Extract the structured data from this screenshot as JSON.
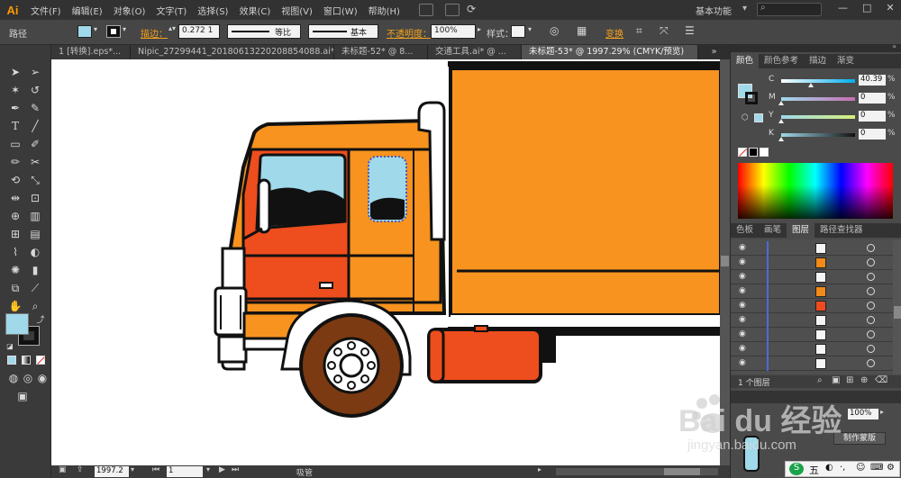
{
  "app": {
    "logo": "Ai",
    "menu": [
      "文件(F)",
      "编辑(E)",
      "对象(O)",
      "文字(T)",
      "选择(S)",
      "效果(C)",
      "视图(V)",
      "窗口(W)",
      "帮助(H)"
    ],
    "workspace": "基本功能",
    "search_placeholder": "",
    "window_buttons": [
      "—",
      "□",
      "✕"
    ]
  },
  "control_bar": {
    "selection_label": "路径",
    "stroke_label": "描边：",
    "stroke_weight": "0.272 1",
    "stroke_profile": "等比",
    "brush": "基本",
    "opacity_label": "不透明度：",
    "opacity_value": "100%",
    "style_label": "样式：",
    "transform_label": "变换",
    "fill_color": "#9fd9ea",
    "stroke_color": "#111111"
  },
  "tabs": [
    {
      "label": "1 [转换].eps*...",
      "active": false
    },
    {
      "label": "Nipic_27299441_20180613220208854088.ai* ...",
      "active": false
    },
    {
      "label": "未标题-52* @ 8...",
      "active": false
    },
    {
      "label": "交通工具.ai* @ ...",
      "active": false
    },
    {
      "label": "未标题-53* @ 1997.29% (CMYK/预览)",
      "active": true
    }
  ],
  "status_bar": {
    "zoom": "1997.2",
    "page": "1",
    "tool_name": "吸管"
  },
  "color_panel": {
    "tabs": [
      {
        "label": "颜色",
        "active": true
      },
      {
        "label": "颜色参考",
        "active": false
      },
      {
        "label": "描边",
        "active": false
      },
      {
        "label": "渐变",
        "active": false
      }
    ],
    "channels": [
      {
        "label": "C",
        "value": "40.39",
        "fraction": 0.4,
        "track": "linear-gradient(90deg,#fff,#00aeef)"
      },
      {
        "label": "M",
        "value": "0",
        "fraction": 0.0,
        "track": "linear-gradient(90deg,#9fd9ea,#c46fb0)"
      },
      {
        "label": "Y",
        "value": "0",
        "fraction": 0.0,
        "track": "linear-gradient(90deg,#9fd9ea,#d7f07a)"
      },
      {
        "label": "K",
        "value": "0",
        "fraction": 0.0,
        "track": "linear-gradient(90deg,#9fd9ea,#111)"
      }
    ],
    "pct_symbol": "%"
  },
  "layers_panel": {
    "tabs": [
      {
        "label": "色板",
        "active": false
      },
      {
        "label": "画笔",
        "active": false
      },
      {
        "label": "图层",
        "active": true
      },
      {
        "label": "路径查找器",
        "active": false
      }
    ],
    "rows": [
      {
        "thumb": "#f5f5f5"
      },
      {
        "thumb": "#f28a1a"
      },
      {
        "thumb": "#f5f5f5"
      },
      {
        "thumb": "#f28a1a"
      },
      {
        "thumb": "#ef4b20"
      },
      {
        "thumb": "#f5f5f5"
      },
      {
        "thumb": "#f5f5f5"
      },
      {
        "thumb": "#f5f5f5"
      },
      {
        "thumb": "#f5f5f5"
      }
    ],
    "layer_count": "1 个图层",
    "transparency_value": "100%",
    "make_mask": "制作蒙版"
  },
  "watermark": {
    "brand": "Bai du 经验",
    "url": "jingyan.baidu.com"
  },
  "ime_bar": "五"
}
